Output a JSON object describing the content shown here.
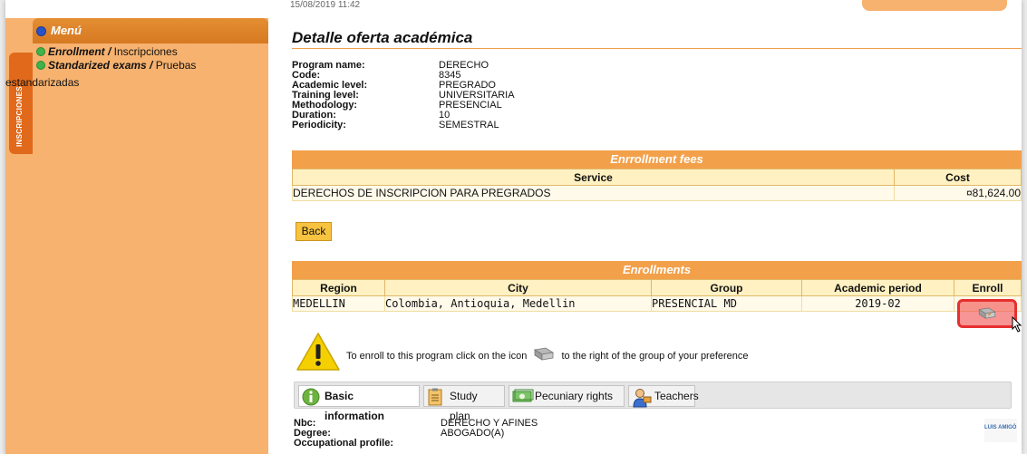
{
  "timestamp": "15/08/2019 11:42",
  "sidebar": {
    "title": "Menú",
    "tab_label": "INSCRIPCIONES",
    "items": [
      {
        "bold": "Enrollment /",
        "rest": " Inscripciones"
      },
      {
        "bold": "Standarized exams /",
        "rest": " Pruebas"
      }
    ],
    "wrap_text": "estandarizadas"
  },
  "page_title": "Detalle oferta académica",
  "details": [
    {
      "k": "Program name:",
      "v": "DERECHO"
    },
    {
      "k": "Code:",
      "v": "8345"
    },
    {
      "k": "Academic level:",
      "v": "PREGRADO"
    },
    {
      "k": "Training level:",
      "v": "UNIVERSITARIA"
    },
    {
      "k": "Methodology:",
      "v": "PRESENCIAL"
    },
    {
      "k": "Duration:",
      "v": "10"
    },
    {
      "k": "Periodicity:",
      "v": "SEMESTRAL"
    }
  ],
  "fees": {
    "title": "Enrrollment fees",
    "headers": [
      "Service",
      "Cost"
    ],
    "rows": [
      [
        "DERECHOS DE INSCRIPCION PARA PREGRADOS",
        "¤81,624.00"
      ]
    ]
  },
  "back_label": "Back",
  "enrollments": {
    "title": "Enrollments",
    "headers": [
      "Region",
      "City",
      "Group",
      "Academic period",
      "Enroll"
    ],
    "rows": [
      [
        "MEDELLIN",
        "Colombia, Antioquia, Medellin",
        "PRESENCIAL MD",
        "2019-02"
      ]
    ]
  },
  "note": {
    "before": "To enroll to this program click on the icon",
    "after": "to the right of the group of your preference"
  },
  "tabs": [
    "Basic information",
    "Study plan",
    "Pecuniary rights",
    "Teachers"
  ],
  "basic": [
    {
      "k": "Nbc:",
      "v": "DERECHO Y AFINES"
    },
    {
      "k": "Degree:",
      "v": "ABOGADO(A)"
    },
    {
      "k": "Occupational profile:",
      "v": ""
    }
  ],
  "logo_text": "LUIS AMIGÓ"
}
